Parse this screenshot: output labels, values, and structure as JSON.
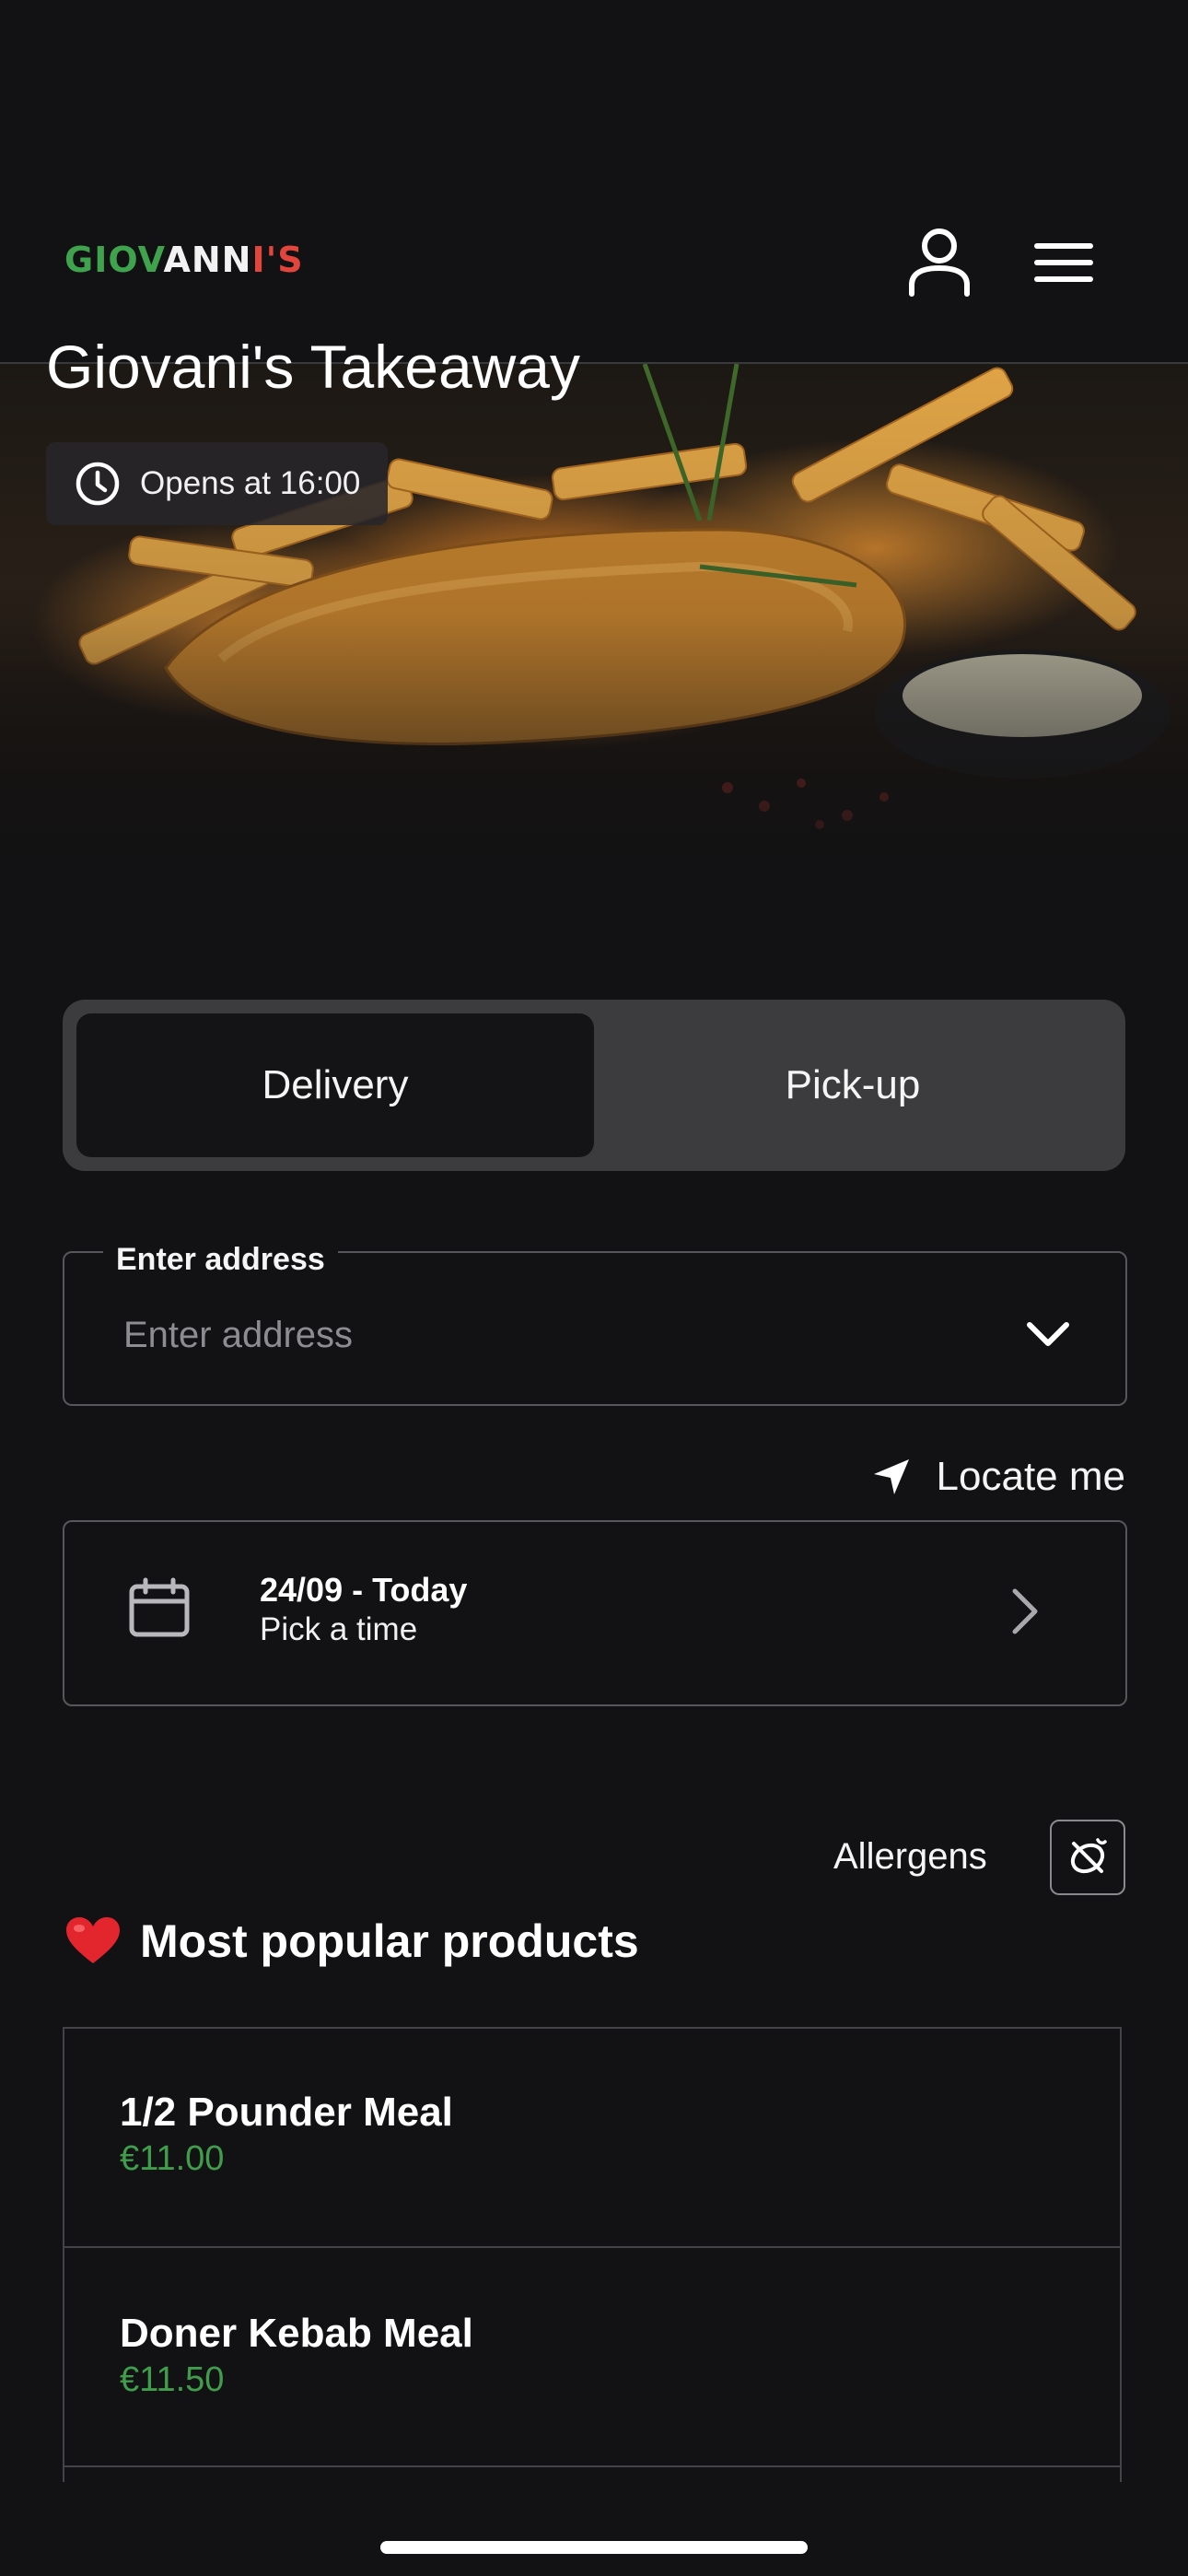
{
  "header": {
    "logo_part1": "GIOV",
    "logo_part2": "ANN",
    "logo_part3": "I'S",
    "icons": {
      "account": "person-icon",
      "menu": "hamburger-icon"
    }
  },
  "hero": {
    "title": "Giovani's Takeaway",
    "opens_text": "Opens at 16:00"
  },
  "order_mode": {
    "options": [
      "Delivery",
      "Pick-up"
    ],
    "selected": "Delivery"
  },
  "address": {
    "label": "Enter address",
    "placeholder": "Enter address",
    "value": ""
  },
  "locate": {
    "label": "Locate me"
  },
  "schedule": {
    "date_text": "24/09 - Today",
    "time_text": "Pick a time"
  },
  "allergens": {
    "label": "Allergens"
  },
  "popular": {
    "title": "Most popular products",
    "emoji": "❤️",
    "products": [
      {
        "name": "1/2 Pounder Meal",
        "price": "€11.00"
      },
      {
        "name": "Doner Kebab Meal",
        "price": "€11.50"
      }
    ]
  },
  "colors": {
    "background": "#121113",
    "price_green": "#3f9d4b",
    "logo_green": "#3fa34d",
    "logo_red": "#e2453c"
  }
}
